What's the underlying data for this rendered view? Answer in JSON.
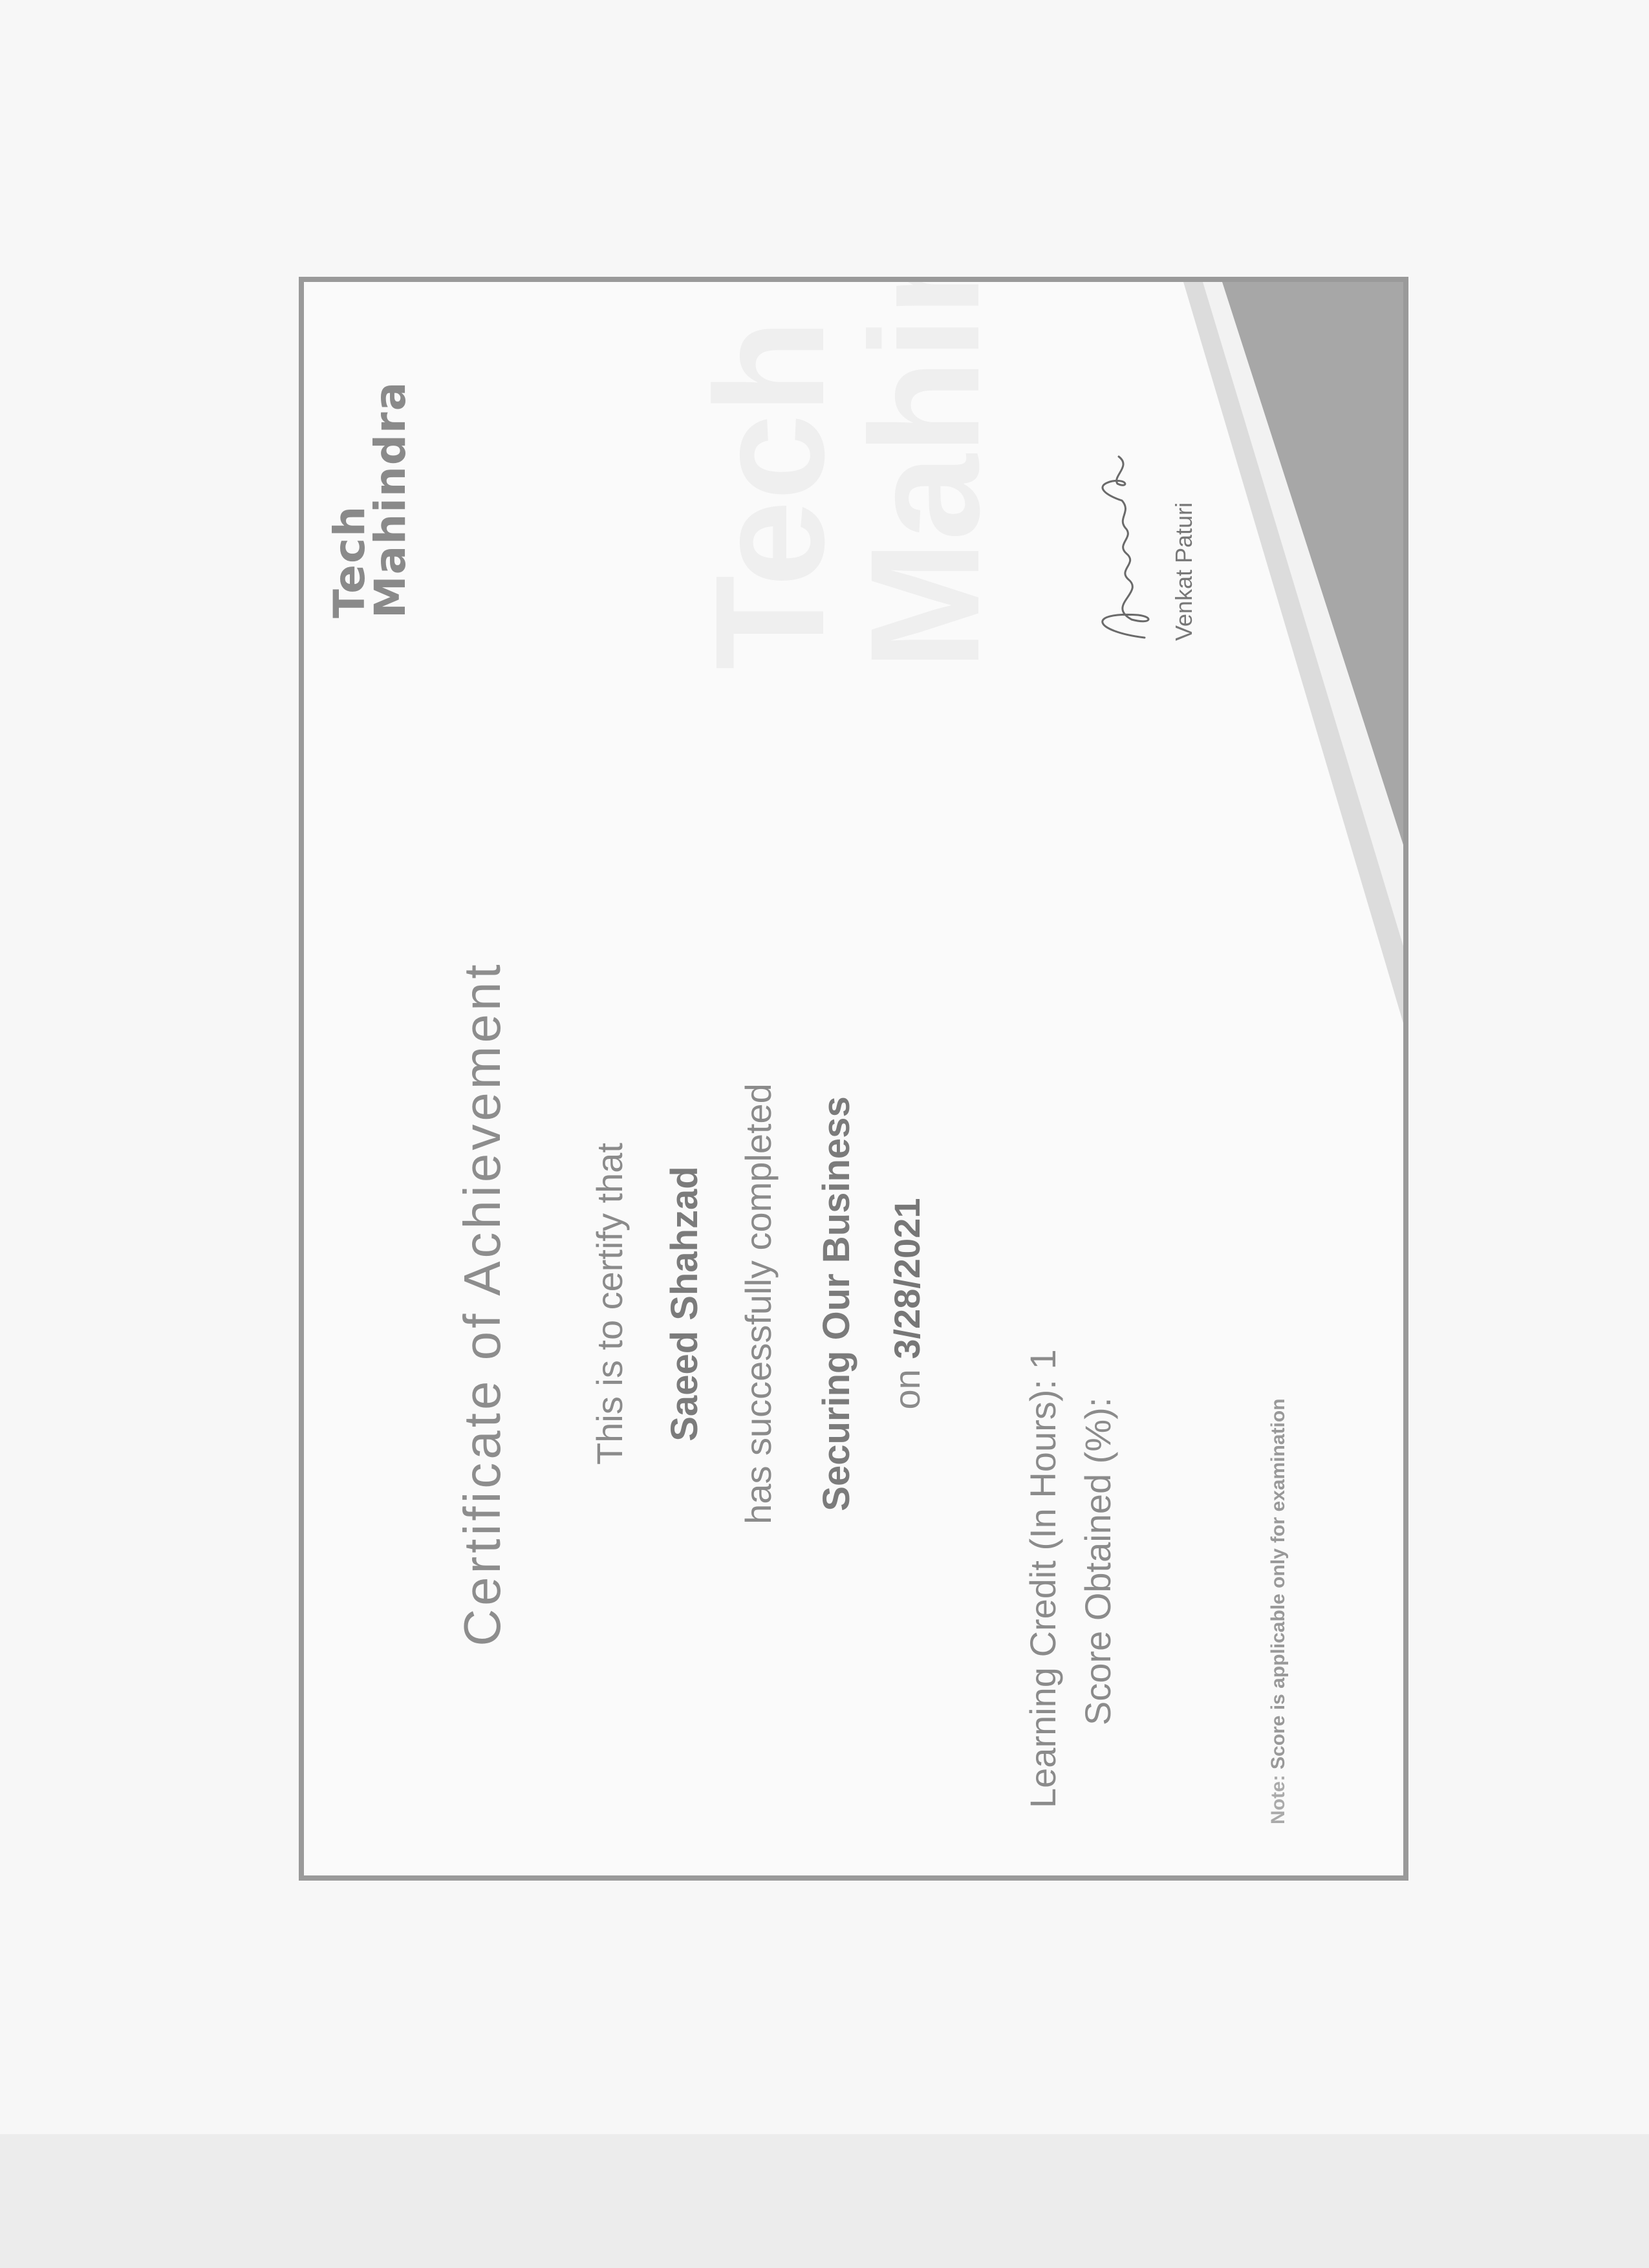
{
  "logo": {
    "line1": "Tech",
    "line2": "Mahindra"
  },
  "certificate": {
    "title": "Certificate of Achievement",
    "intro": "This is to certify that",
    "recipient": "Saeed Shahzad",
    "completed_text": "has successfully completed",
    "course": "Securing Our Business",
    "date_prefix": "on",
    "date": "3/28/2021"
  },
  "details": {
    "learning_credit_label": "Learning Credit (In Hours):",
    "learning_credit_value": "1",
    "score_label": "Score Obtained (%):"
  },
  "signatory": {
    "name": "Venkat Paturi",
    "signature_text": "Venkat Paturi"
  },
  "note": {
    "label": "Note:",
    "text": "Score is applicable only for examination"
  },
  "colors": {
    "frame": "#9a9a9a",
    "wedge": "#a7a7a7",
    "text": "#8b8b8b"
  }
}
